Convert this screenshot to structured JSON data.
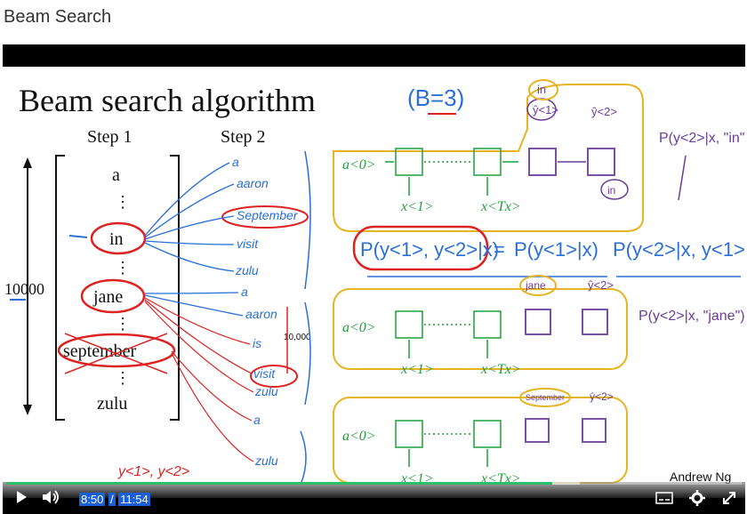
{
  "page": {
    "title": "Beam Search"
  },
  "slide": {
    "heading": "Beam search algorithm",
    "beam_width_note": "(B=3)",
    "step1_label": "Step 1",
    "step2_label": "Step 2",
    "vocab_size": "10000",
    "vocab_words": [
      "a",
      "in",
      "jane",
      "september",
      "zulu"
    ],
    "step2_words_in": [
      "a",
      "aaron",
      "September",
      "visit",
      "zulu"
    ],
    "step2_words_jane": [
      "a",
      "aaron",
      "is",
      "visit",
      "zulu"
    ],
    "step2_words_sept": [
      "a",
      "zulu"
    ],
    "vocab_count_note": "10,000",
    "equation_lhs": "P(y<1>, y<2>|x)",
    "equation_eq": "=",
    "equation_rhs1": "P(y<1>|x)",
    "equation_rhs2": "P(y<2>|x, y<1>)",
    "note_in": "P(y<2>|x, \"in\")",
    "note_jane": "P(y<2>|x, \"jane\")",
    "input_bubble_1": "in",
    "input_bubble_2": "jane",
    "input_bubble_3": "September",
    "output_label": "ŷ<2>",
    "output_label_first": "ŷ<1>",
    "feed_label": "in",
    "enc_a0": "a<0>",
    "enc_x1": "x<1>",
    "enc_xtx": "x<Tx>",
    "y_handnote": "y<1>, y<2>",
    "author": "Andrew Ng"
  },
  "player": {
    "current_time": "8:50",
    "separator": "/",
    "duration": "11:54",
    "progress": 0.743,
    "buffered": 0.78,
    "accent_color": "#2bbf6a",
    "icons": [
      "play-icon",
      "volume-icon",
      "captions-icon",
      "settings-icon",
      "fullscreen-icon"
    ]
  }
}
